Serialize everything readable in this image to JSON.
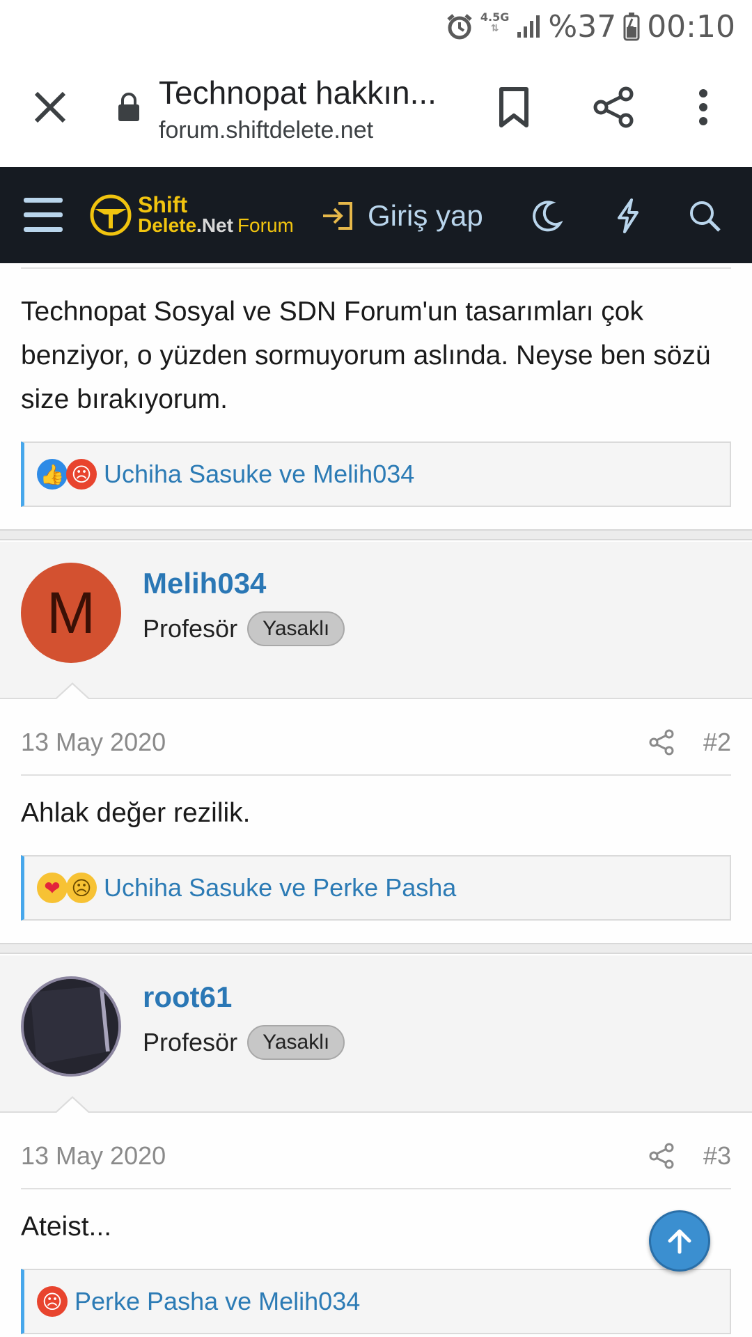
{
  "status_bar": {
    "network": "4.5G",
    "battery": "%37",
    "time": "00:10"
  },
  "browser": {
    "title": "Technopat hakkın...",
    "url": "forum.shiftdelete.net"
  },
  "forum_header": {
    "logo_shift": "Shift",
    "logo_delete": "Delete",
    "logo_net": ".Net",
    "logo_forum": "Forum",
    "login_label": "Giriş yap"
  },
  "posts": [
    {
      "body": "Technopat Sosyal ve SDN Forum'un tasarımları çok benziyor, o yüzden sormuyorum aslında. Neyse ben sözü size bırakıyorum.",
      "reactions_text": "Uchiha Sasuke ve Melih034",
      "reaction_icons": [
        "like-icon",
        "angry-icon"
      ]
    },
    {
      "username": "Melih034",
      "avatar_letter": "M",
      "user_title": "Profesör",
      "badge": "Yasaklı",
      "date": "13 May 2020",
      "number": "#2",
      "body": "Ahlak değer rezilik.",
      "reactions_text": "Uchiha Sasuke ve Perke Pasha",
      "reaction_icons": [
        "love-icon",
        "confused-icon"
      ]
    },
    {
      "username": "root61",
      "user_title": "Profesör",
      "badge": "Yasaklı",
      "date": "13 May 2020",
      "number": "#3",
      "body": "Ateist...",
      "reactions_text": "Perke Pasha ve Melih034",
      "reaction_icons": [
        "angry-icon"
      ]
    }
  ],
  "colors": {
    "header_bg": "#161b22",
    "link": "#2a77b5",
    "accent": "#47a7eb",
    "avatar_m": "#d35130"
  }
}
